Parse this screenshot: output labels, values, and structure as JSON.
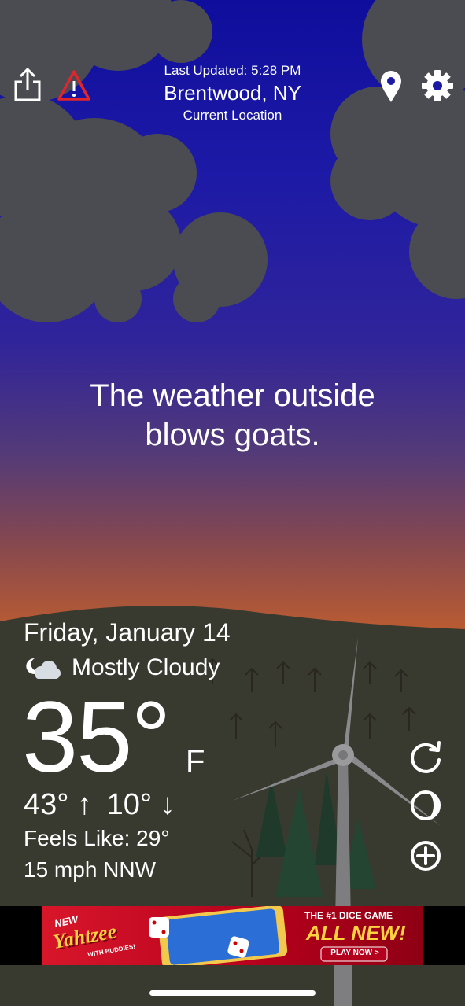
{
  "header": {
    "last_updated": "Last Updated: 5:28 PM",
    "city": "Brentwood, NY",
    "location_label": "Current Location"
  },
  "tagline": {
    "line1": "The weather outside",
    "line2": "blows goats."
  },
  "weather": {
    "date": "Friday, January 14",
    "condition": "Mostly Cloudy",
    "condition_icon": "partly-cloudy-night-icon",
    "temperature": "35°",
    "unit": "F",
    "high": "43°",
    "low": "10°",
    "feels_like": "Feels Like: 29°",
    "wind": "15 mph NNW"
  },
  "ad": {
    "badge": "NEW",
    "title": "Yahtzee",
    "subtitle": "WITH BUDDIES!",
    "headline_small": "THE #1 DICE GAME",
    "headline_big": "ALL NEW!",
    "cta": "PLAY NOW >"
  },
  "colors": {
    "sky_top": "#0f0e9c",
    "sky_horizon": "#d96e22",
    "ground": "#383a30"
  }
}
